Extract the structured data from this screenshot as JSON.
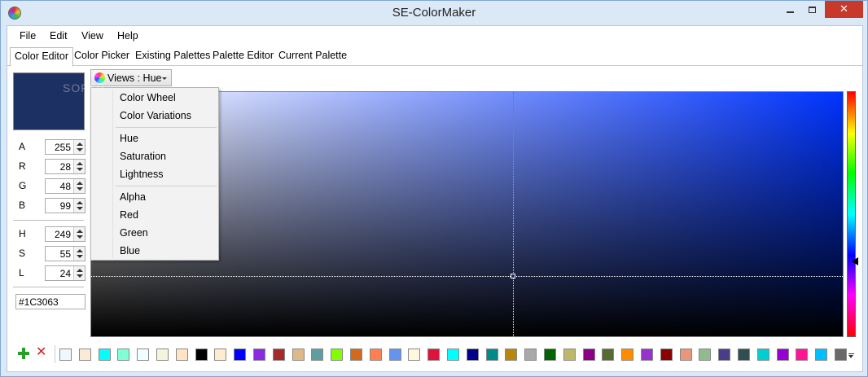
{
  "window": {
    "title": "SE-ColorMaker",
    "close_glyph": "✕"
  },
  "menubar": [
    "File",
    "Edit",
    "View",
    "Help"
  ],
  "tabs": [
    "Color Editor",
    "Color Picker",
    "Existing Palettes",
    "Palette Editor",
    "Current Palette"
  ],
  "current_color": "#1C3063",
  "watermark": "SOFTP",
  "fields": {
    "a": {
      "label": "A",
      "value": "255"
    },
    "r": {
      "label": "R",
      "value": "28"
    },
    "g": {
      "label": "G",
      "value": "48"
    },
    "b": {
      "label": "B",
      "value": "99"
    },
    "h": {
      "label": "H",
      "value": "249"
    },
    "s": {
      "label": "S",
      "value": "55"
    },
    "l": {
      "label": "L",
      "value": "24"
    }
  },
  "hex_value": "#1C3063",
  "views_button": {
    "label": "Views : Hue"
  },
  "views_menu": {
    "group1": [
      "Color Wheel",
      "Color Variations"
    ],
    "group2": [
      "Hue",
      "Saturation",
      "Lightness"
    ],
    "group3": [
      "Alpha",
      "Red",
      "Green",
      "Blue"
    ]
  },
  "palette": [
    "#F0F8FF",
    "#FAEBD7",
    "#00FFFF",
    "#7FFFD4",
    "#F0FFFF",
    "#F5F5DC",
    "#FFE4C4",
    "#000000",
    "#FFEBCD",
    "#0000FF",
    "#8A2BE2",
    "#A52A2A",
    "#DEB887",
    "#5F9EA0",
    "#7FFF00",
    "#D2691E",
    "#FF7F50",
    "#6495ED",
    "#FFF8DC",
    "#DC143C",
    "#00FFFF",
    "#00008B",
    "#008B8B",
    "#B8860B",
    "#A9A9A9",
    "#006400",
    "#BDB76B",
    "#8B008B",
    "#556B2F",
    "#FF8C00",
    "#9932CC",
    "#8B0000",
    "#E9967A",
    "#8FBC8F",
    "#483D8B",
    "#2F4F4F",
    "#00CED1",
    "#9400D3",
    "#FF1493",
    "#00BFFF",
    "#696969"
  ]
}
